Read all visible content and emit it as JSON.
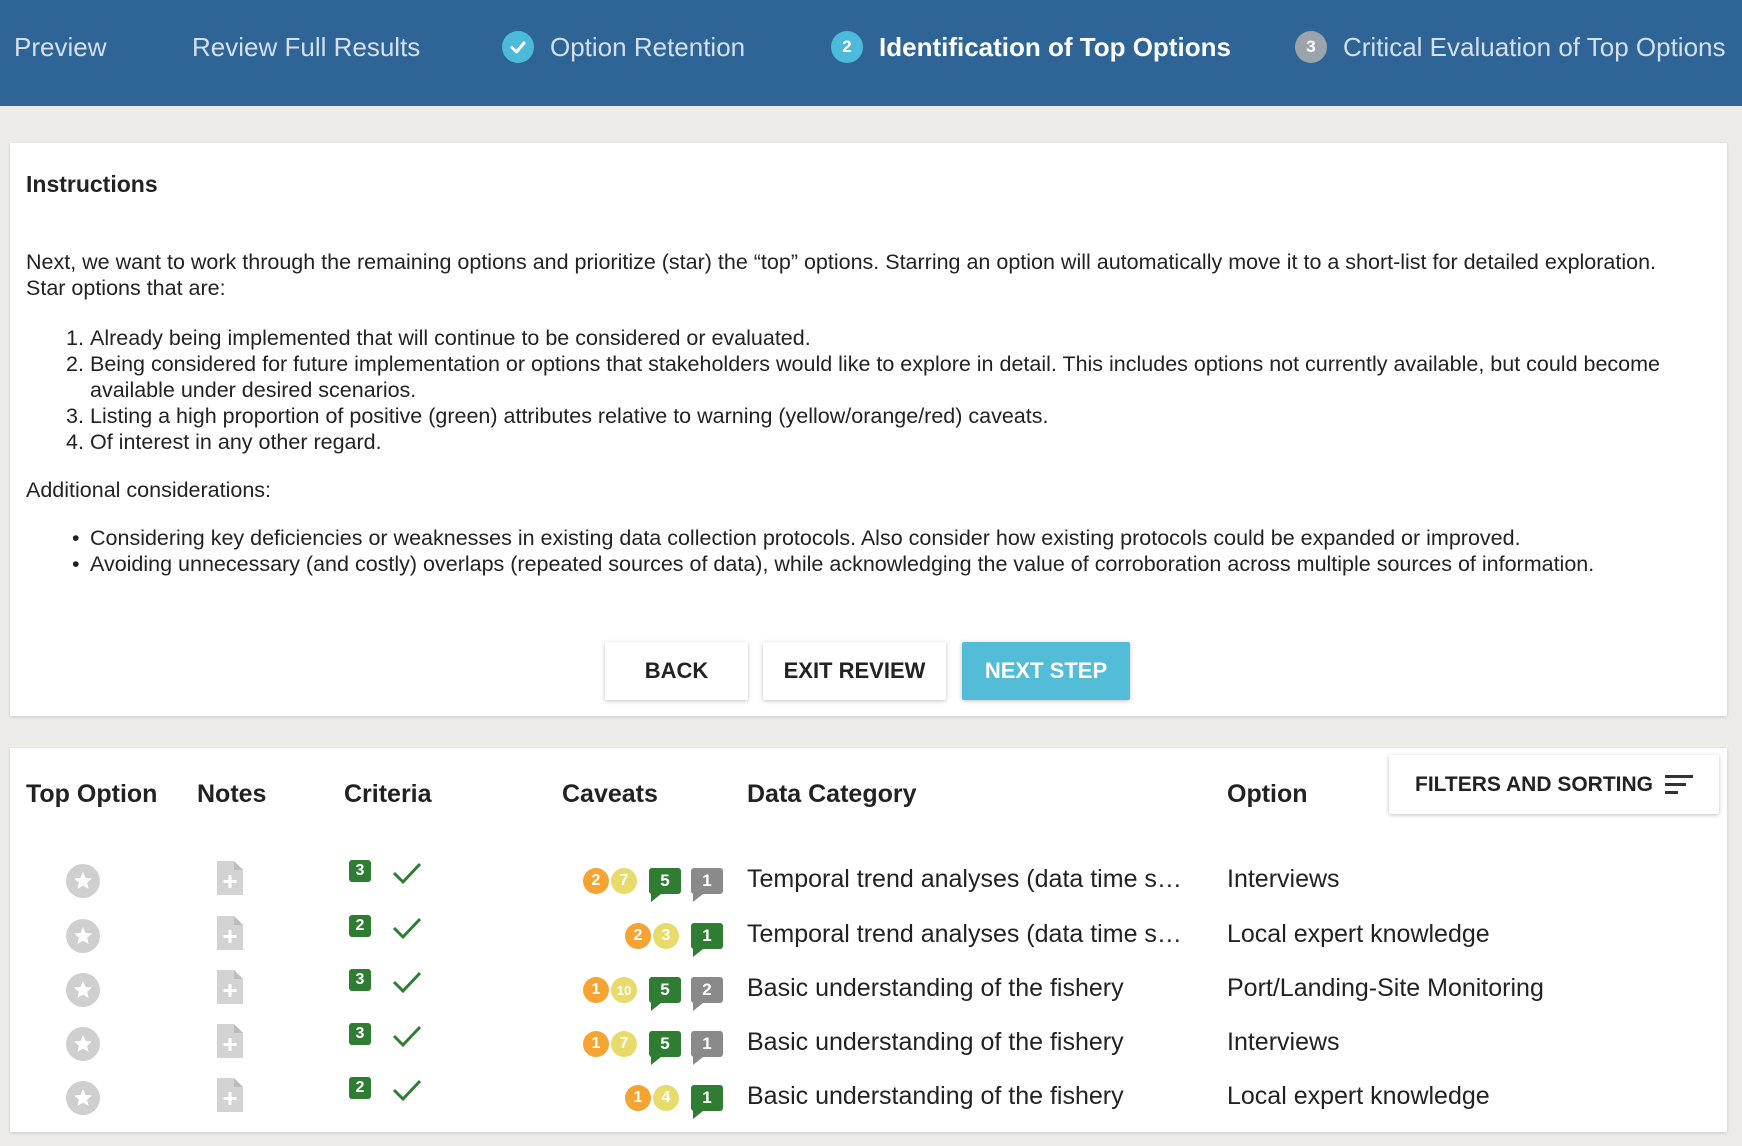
{
  "stepbar": {
    "steps": [
      {
        "label": "Preview",
        "state": "link"
      },
      {
        "label": "Review Full Results",
        "state": "link"
      },
      {
        "label": "Option Retention",
        "state": "done"
      },
      {
        "label": "Identification of Top Options",
        "state": "active",
        "number": "2"
      },
      {
        "label": "Critical Evaluation of Top Options",
        "state": "pending",
        "number": "3"
      }
    ]
  },
  "instructions": {
    "title": "Instructions",
    "intro": "Next, we want to work through the remaining options and prioritize (star) the “top” options. Starring an option will automatically move it to a short-list for detailed exploration. Star options that are:",
    "numbered": [
      {
        "num": "1.",
        "text": "Already being implemented that will continue to be considered or evaluated."
      },
      {
        "num": "2.",
        "text": "Being considered for future implementation or options that stakeholders would like to explore in detail. This includes options not currently available, but could become available under desired scenarios."
      },
      {
        "num": "3.",
        "text": "Listing a high proportion of positive (green) attributes relative to warning (yellow/orange/red) caveats."
      },
      {
        "num": "4.",
        "text": "Of interest in any other regard."
      }
    ],
    "additional_title": "Additional considerations:",
    "bullets": [
      "Considering key deficiencies or weaknesses in existing data collection protocols. Also consider how existing protocols could be expanded or improved.",
      "Avoiding unnecessary (and costly) overlaps (repeated sources of data), while acknowledging the value of corroboration across multiple sources of information."
    ],
    "buttons": {
      "back": "BACK",
      "exit": "EXIT REVIEW",
      "next": "NEXT STEP"
    }
  },
  "table": {
    "headers": {
      "top_option": "Top Option",
      "notes": "Notes",
      "criteria": "Criteria",
      "caveats": "Caveats",
      "data_category": "Data Category",
      "option": "Option"
    },
    "filters_label": "FILTERS AND SORTING",
    "rows": [
      {
        "criteria": "3",
        "orange": "2",
        "yellow": "7",
        "green": "5",
        "gray": "1",
        "category": "Temporal trend analyses (data time s…",
        "option": "Interviews"
      },
      {
        "criteria": "2",
        "orange": "2",
        "yellow": "3",
        "green": "1",
        "gray": "",
        "category": "Temporal trend analyses (data time s…",
        "option": "Local expert knowledge"
      },
      {
        "criteria": "3",
        "orange": "1",
        "yellow": "10",
        "green": "5",
        "gray": "2",
        "category": "Basic understanding of the fishery",
        "option": "Port/Landing-Site Monitoring"
      },
      {
        "criteria": "3",
        "orange": "1",
        "yellow": "7",
        "green": "5",
        "gray": "1",
        "category": "Basic understanding of the fishery",
        "option": "Interviews"
      },
      {
        "criteria": "2",
        "orange": "1",
        "yellow": "4",
        "green": "1",
        "gray": "",
        "category": "Basic understanding of the fishery",
        "option": "Local expert knowledge"
      }
    ]
  },
  "colors": {
    "header_bg": "#2e6496",
    "accent": "#4bbbd9",
    "next_button": "#53bcd6",
    "green": "#2e7d32",
    "orange": "#f5a333",
    "yellow": "#e8db6b",
    "gray": "#8a8a8a"
  }
}
